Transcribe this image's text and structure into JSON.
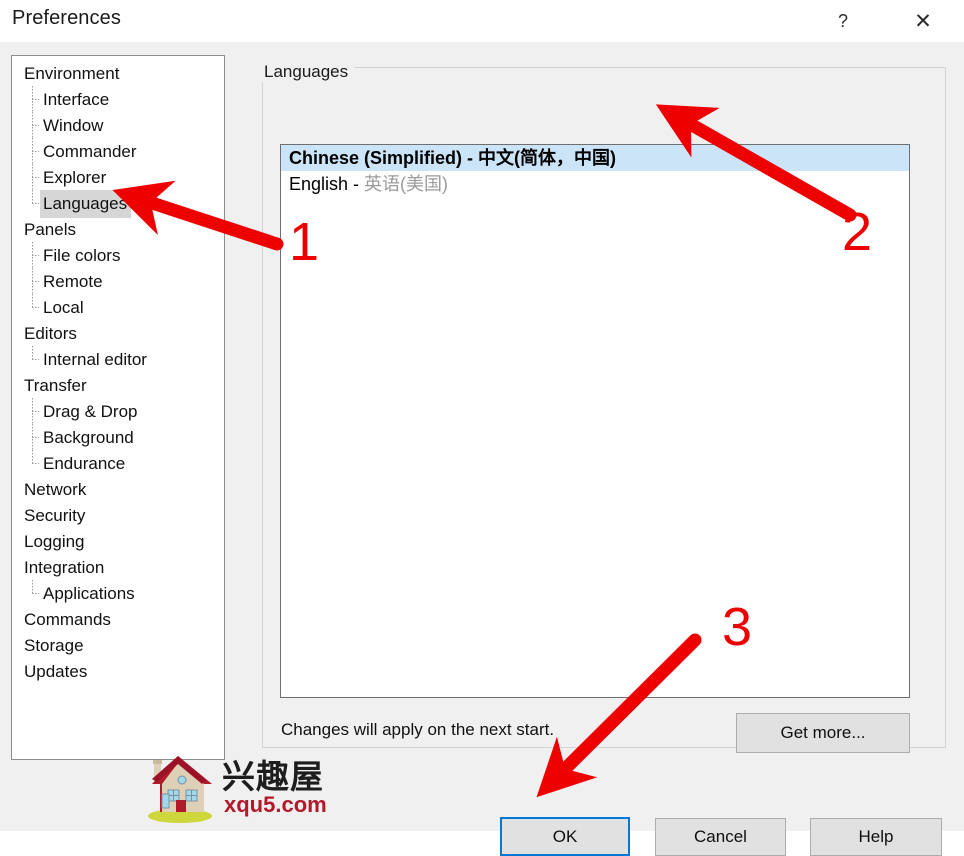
{
  "window": {
    "title": "Preferences",
    "help_button": "?",
    "close_button": "✕"
  },
  "tree": {
    "items": [
      {
        "label": "Environment",
        "level": 0,
        "selected": false
      },
      {
        "label": "Interface",
        "level": 1,
        "selected": false
      },
      {
        "label": "Window",
        "level": 1,
        "selected": false
      },
      {
        "label": "Commander",
        "level": 1,
        "selected": false
      },
      {
        "label": "Explorer",
        "level": 1,
        "selected": false
      },
      {
        "label": "Languages",
        "level": 1,
        "selected": true,
        "last": true
      },
      {
        "label": "Panels",
        "level": 0,
        "selected": false
      },
      {
        "label": "File colors",
        "level": 1,
        "selected": false
      },
      {
        "label": "Remote",
        "level": 1,
        "selected": false
      },
      {
        "label": "Local",
        "level": 1,
        "selected": false,
        "last": true
      },
      {
        "label": "Editors",
        "level": 0,
        "selected": false
      },
      {
        "label": "Internal editor",
        "level": 1,
        "selected": false,
        "last": true
      },
      {
        "label": "Transfer",
        "level": 0,
        "selected": false
      },
      {
        "label": "Drag & Drop",
        "level": 1,
        "selected": false
      },
      {
        "label": "Background",
        "level": 1,
        "selected": false
      },
      {
        "label": "Endurance",
        "level": 1,
        "selected": false,
        "last": true
      },
      {
        "label": "Network",
        "level": 0,
        "selected": false
      },
      {
        "label": "Security",
        "level": 0,
        "selected": false
      },
      {
        "label": "Logging",
        "level": 0,
        "selected": false
      },
      {
        "label": "Integration",
        "level": 0,
        "selected": false
      },
      {
        "label": "Applications",
        "level": 1,
        "selected": false,
        "last": true
      },
      {
        "label": "Commands",
        "level": 0,
        "selected": false
      },
      {
        "label": "Storage",
        "level": 0,
        "selected": false
      },
      {
        "label": "Updates",
        "level": 0,
        "selected": false
      }
    ]
  },
  "groupbox": {
    "title": "Languages"
  },
  "languages": {
    "rows": [
      {
        "name": "Chinese (Simplified) - ",
        "native": "中文(简体，中国)",
        "selected": true,
        "dim_native": false
      },
      {
        "name": "English - ",
        "native": "英语(美国)",
        "selected": false,
        "dim_native": true
      }
    ]
  },
  "hint": {
    "text": "Changes will apply on the next start."
  },
  "buttons": {
    "get_more": "Get more...",
    "ok": "OK",
    "cancel": "Cancel",
    "help": "Help"
  },
  "annotations": {
    "steps": [
      "1",
      "2",
      "3"
    ],
    "color": "#ee0000"
  },
  "watermark": {
    "cn_text": "兴趣屋",
    "url_text": "xqu5.com"
  },
  "colors": {
    "selection_blue": "#cce4f7",
    "tree_selection_gray": "#d6d6d6",
    "focus_border": "#0078d7",
    "dialog_bg": "#f0f0f0",
    "annotation_red": "#ee0000"
  }
}
